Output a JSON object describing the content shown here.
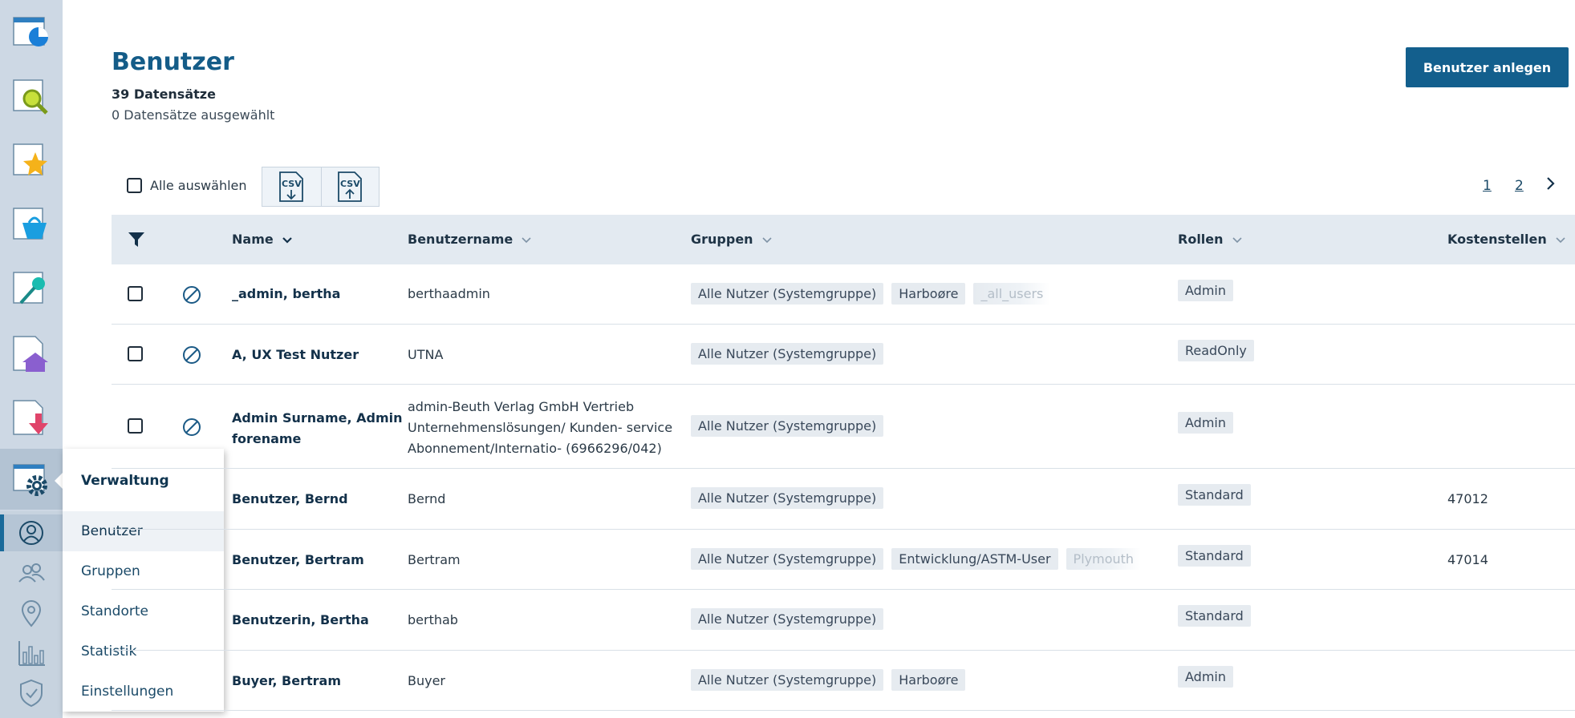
{
  "menu": {
    "title": "Verwaltung",
    "items": [
      {
        "label": "Benutzer",
        "active": true
      },
      {
        "label": "Gruppen"
      },
      {
        "label": "Standorte"
      },
      {
        "label": "Statistik"
      },
      {
        "label": "Einstellungen"
      }
    ]
  },
  "page": {
    "title": "Benutzer",
    "record_count": "39 Datensätze",
    "selected_count": "0 Datensätze ausgewählt",
    "create_button": "Benutzer anlegen"
  },
  "toolbar": {
    "select_all": "Alle auswählen",
    "csv_export_label": "CSV",
    "csv_import_label": "CSV"
  },
  "pagination": {
    "pages": [
      "1",
      "2"
    ]
  },
  "table": {
    "columns": [
      "Name",
      "Benutzername",
      "Gruppen",
      "Rollen",
      "Kostenstellen"
    ],
    "rows": [
      {
        "name": "_admin, bertha",
        "username": "berthaadmin",
        "groups": [
          "Alle Nutzer (Systemgruppe)",
          "Harboøre",
          "_all_users"
        ],
        "role": "Admin",
        "cost_center": ""
      },
      {
        "name": "A, UX Test Nutzer",
        "username": "UTNA",
        "groups": [
          "Alle Nutzer (Systemgruppe)"
        ],
        "role": "ReadOnly",
        "cost_center": ""
      },
      {
        "name_line1": "Admin Surname, Admin",
        "name_line2": "forename",
        "username_line1": "admin-Beuth Verlag GmbH Vertrieb",
        "username_line2": "Unternehmenslösungen/ Kunden- service",
        "username_line3": "Abonnement/Internatio- (6966296/042)",
        "groups": [
          "Alle Nutzer (Systemgruppe)"
        ],
        "role": "Admin",
        "cost_center": ""
      },
      {
        "name": "Benutzer, Bernd",
        "username": "Bernd",
        "groups": [
          "Alle Nutzer (Systemgruppe)"
        ],
        "role": "Standard",
        "cost_center": "47012"
      },
      {
        "name": "Benutzer, Bertram",
        "username": "Bertram",
        "groups": [
          "Alle Nutzer (Systemgruppe)",
          "Entwicklung/ASTM-User",
          "Plymouth"
        ],
        "role": "Standard",
        "cost_center": "47014"
      },
      {
        "name": "Benutzerin, Bertha",
        "username": "berthab",
        "groups": [
          "Alle Nutzer (Systemgruppe)"
        ],
        "role": "Standard",
        "cost_center": ""
      },
      {
        "name": "Buyer, Bertram",
        "username": "Buyer",
        "groups": [
          "Alle Nutzer (Systemgruppe)",
          "Harboøre"
        ],
        "role": "Admin",
        "cost_center": ""
      }
    ]
  },
  "icons": {
    "sidebar": [
      "dashboard-icon",
      "search-icon",
      "favorites-icon",
      "cart-icon",
      "key-icon",
      "home-icon",
      "download-icon",
      "settings-icon"
    ],
    "submenu": [
      "user-icon",
      "users-icon",
      "location-icon",
      "chart-icon",
      "shield-icon"
    ]
  },
  "colors": {
    "primary": "#135f8d",
    "title": "#145c88",
    "sidebar": "#cdd8e4",
    "table_header": "#e3eaf1"
  }
}
